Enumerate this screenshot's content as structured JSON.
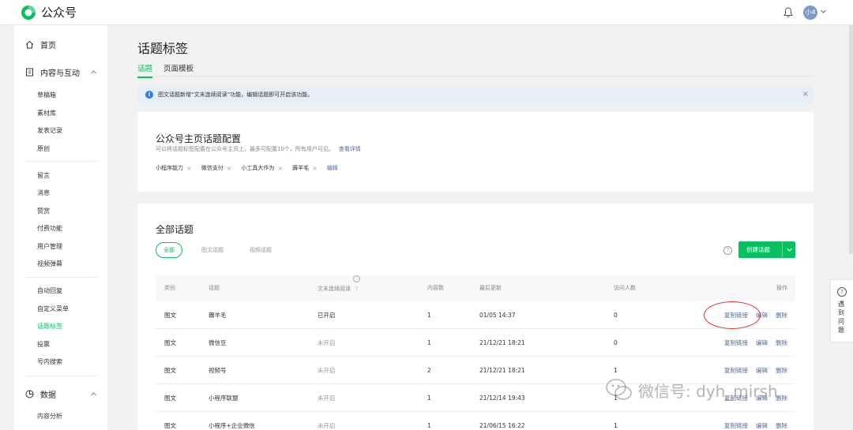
{
  "app": {
    "brand": "公众号",
    "avatar_text": "小4"
  },
  "sidebar": {
    "groups": [
      {
        "label": "首页"
      },
      {
        "label": "内容与互动"
      },
      {
        "label": "数据"
      }
    ],
    "items": [
      "草稿箱",
      "素材库",
      "发表记录",
      "原创",
      "留言",
      "消息",
      "赞赏",
      "付费功能",
      "用户管理",
      "视频弹幕",
      "自动回复",
      "自定义菜单",
      "话题标签",
      "投票",
      "号内搜索",
      "内容分析"
    ],
    "active_item": "话题标签"
  },
  "page": {
    "title": "话题标签",
    "tabs": [
      {
        "label": "话题",
        "active": true
      },
      {
        "label": "页面模板",
        "active": false
      }
    ]
  },
  "notice": {
    "text": "图文话题新增“文末连续阅读”功能，编辑话题即可开启该功能。"
  },
  "homepage_config": {
    "title": "公众号主页话题配置",
    "subtitle": "可以将话题标签配置在公众号主页上，最多可配置10个，所有用户可见。",
    "detail_link": "查看详情",
    "tags": [
      "小程序能力",
      "微信支付",
      "小工具大作为",
      "薅羊毛"
    ],
    "edit_label": "编辑"
  },
  "all_topics": {
    "title": "全部话题",
    "filters": [
      "全部",
      "图文话题",
      "视频话题"
    ],
    "create_button": "创建话题",
    "columns": [
      "类别",
      "话题",
      "文末连续阅读",
      "内容数",
      "最后更新",
      "访问人数",
      "操作"
    ],
    "rows": [
      {
        "type": "图文",
        "topic": "薅羊毛",
        "read": "已开启",
        "read_on": true,
        "count": "1",
        "updated": "01/05 14:37",
        "visitors": "0"
      },
      {
        "type": "图文",
        "topic": "微信豆",
        "read": "未开启",
        "read_on": false,
        "count": "1",
        "updated": "21/12/21 18:21",
        "visitors": "0"
      },
      {
        "type": "图文",
        "topic": "视频号",
        "read": "未开启",
        "read_on": false,
        "count": "2",
        "updated": "21/12/21 18:21",
        "visitors": "1"
      },
      {
        "type": "图文",
        "topic": "小程序联盟",
        "read": "未开启",
        "read_on": false,
        "count": "1",
        "updated": "21/12/14 19:43",
        "visitors": "1"
      },
      {
        "type": "图文",
        "topic": "小程序+企业微信",
        "read": "未开启",
        "read_on": false,
        "count": "1",
        "updated": "21/06/15 16:22",
        "visitors": "1"
      }
    ],
    "actions": [
      "复制链接",
      "编辑",
      "删除"
    ]
  },
  "floating_help": {
    "text": "遇到问题"
  },
  "watermark": {
    "text": "微信号: dyh_mirsh"
  },
  "colors": {
    "accent": "#07c160",
    "link": "#576b95",
    "annotation": "#e03131"
  }
}
